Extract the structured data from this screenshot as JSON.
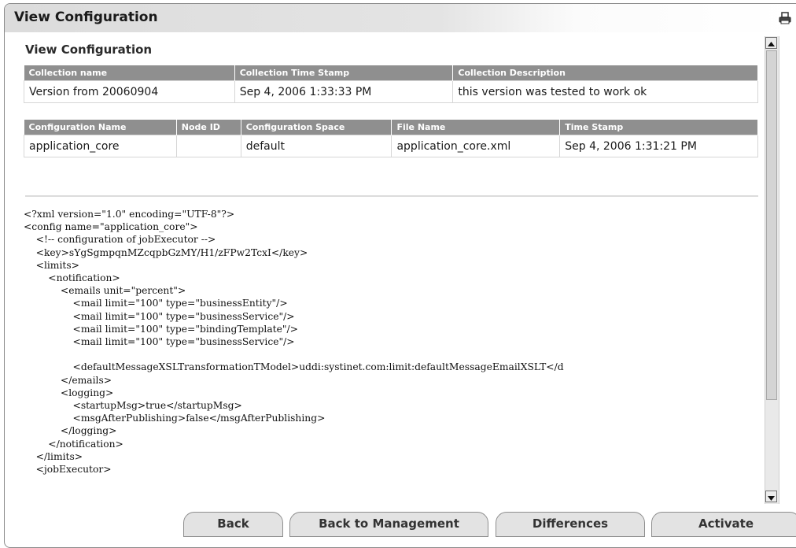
{
  "window": {
    "title": "View Configuration"
  },
  "icons": {
    "print": "printer-icon",
    "scroll_up": "arrow-up-icon",
    "scroll_down": "arrow-down-icon"
  },
  "section": {
    "heading": "View Configuration"
  },
  "collection_table": {
    "headers": [
      "Collection name",
      "Collection Time Stamp",
      "Collection Description"
    ],
    "rows": [
      [
        "Version from 20060904",
        "Sep 4, 2006 1:33:33 PM",
        "this version was tested to work ok"
      ]
    ]
  },
  "configuration_table": {
    "headers": [
      "Configuration Name",
      "Node ID",
      "Configuration Space",
      "File Name",
      "Time Stamp"
    ],
    "rows": [
      [
        "application_core",
        "",
        "default",
        "application_core.xml",
        "Sep 4, 2006 1:31:21 PM"
      ]
    ]
  },
  "xml_lines": [
    "<?xml version=\"1.0\" encoding=\"UTF-8\"?>",
    "<config name=\"application_core\">",
    "    <!-- configuration of jobExecutor -->",
    "    <key>sYgSgmpqnMZcqpbGzMY/H1/zFPw2TcxI</key>",
    "    <limits>",
    "        <notification>",
    "            <emails unit=\"percent\">",
    "                <mail limit=\"100\" type=\"businessEntity\"/>",
    "                <mail limit=\"100\" type=\"businessService\"/>",
    "                <mail limit=\"100\" type=\"bindingTemplate\"/>",
    "                <mail limit=\"100\" type=\"businessService\"/>",
    "",
    "                <defaultMessageXSLTransformationTModel>uddi:systinet.com:limit:defaultMessageEmailXSLT</d",
    "            </emails>",
    "            <logging>",
    "                <startupMsg>true</startupMsg>",
    "                <msgAfterPublishing>false</msgAfterPublishing>",
    "            </logging>",
    "        </notification>",
    "    </limits>",
    "    <jobExecutor>"
  ],
  "buttons": {
    "back": "Back",
    "back_to_management": "Back to Management",
    "differences": "Differences",
    "activate": "Activate"
  },
  "colors": {
    "table_header_bg": "#8f8f8f",
    "title_gradient_start": "#dcdcdc"
  }
}
